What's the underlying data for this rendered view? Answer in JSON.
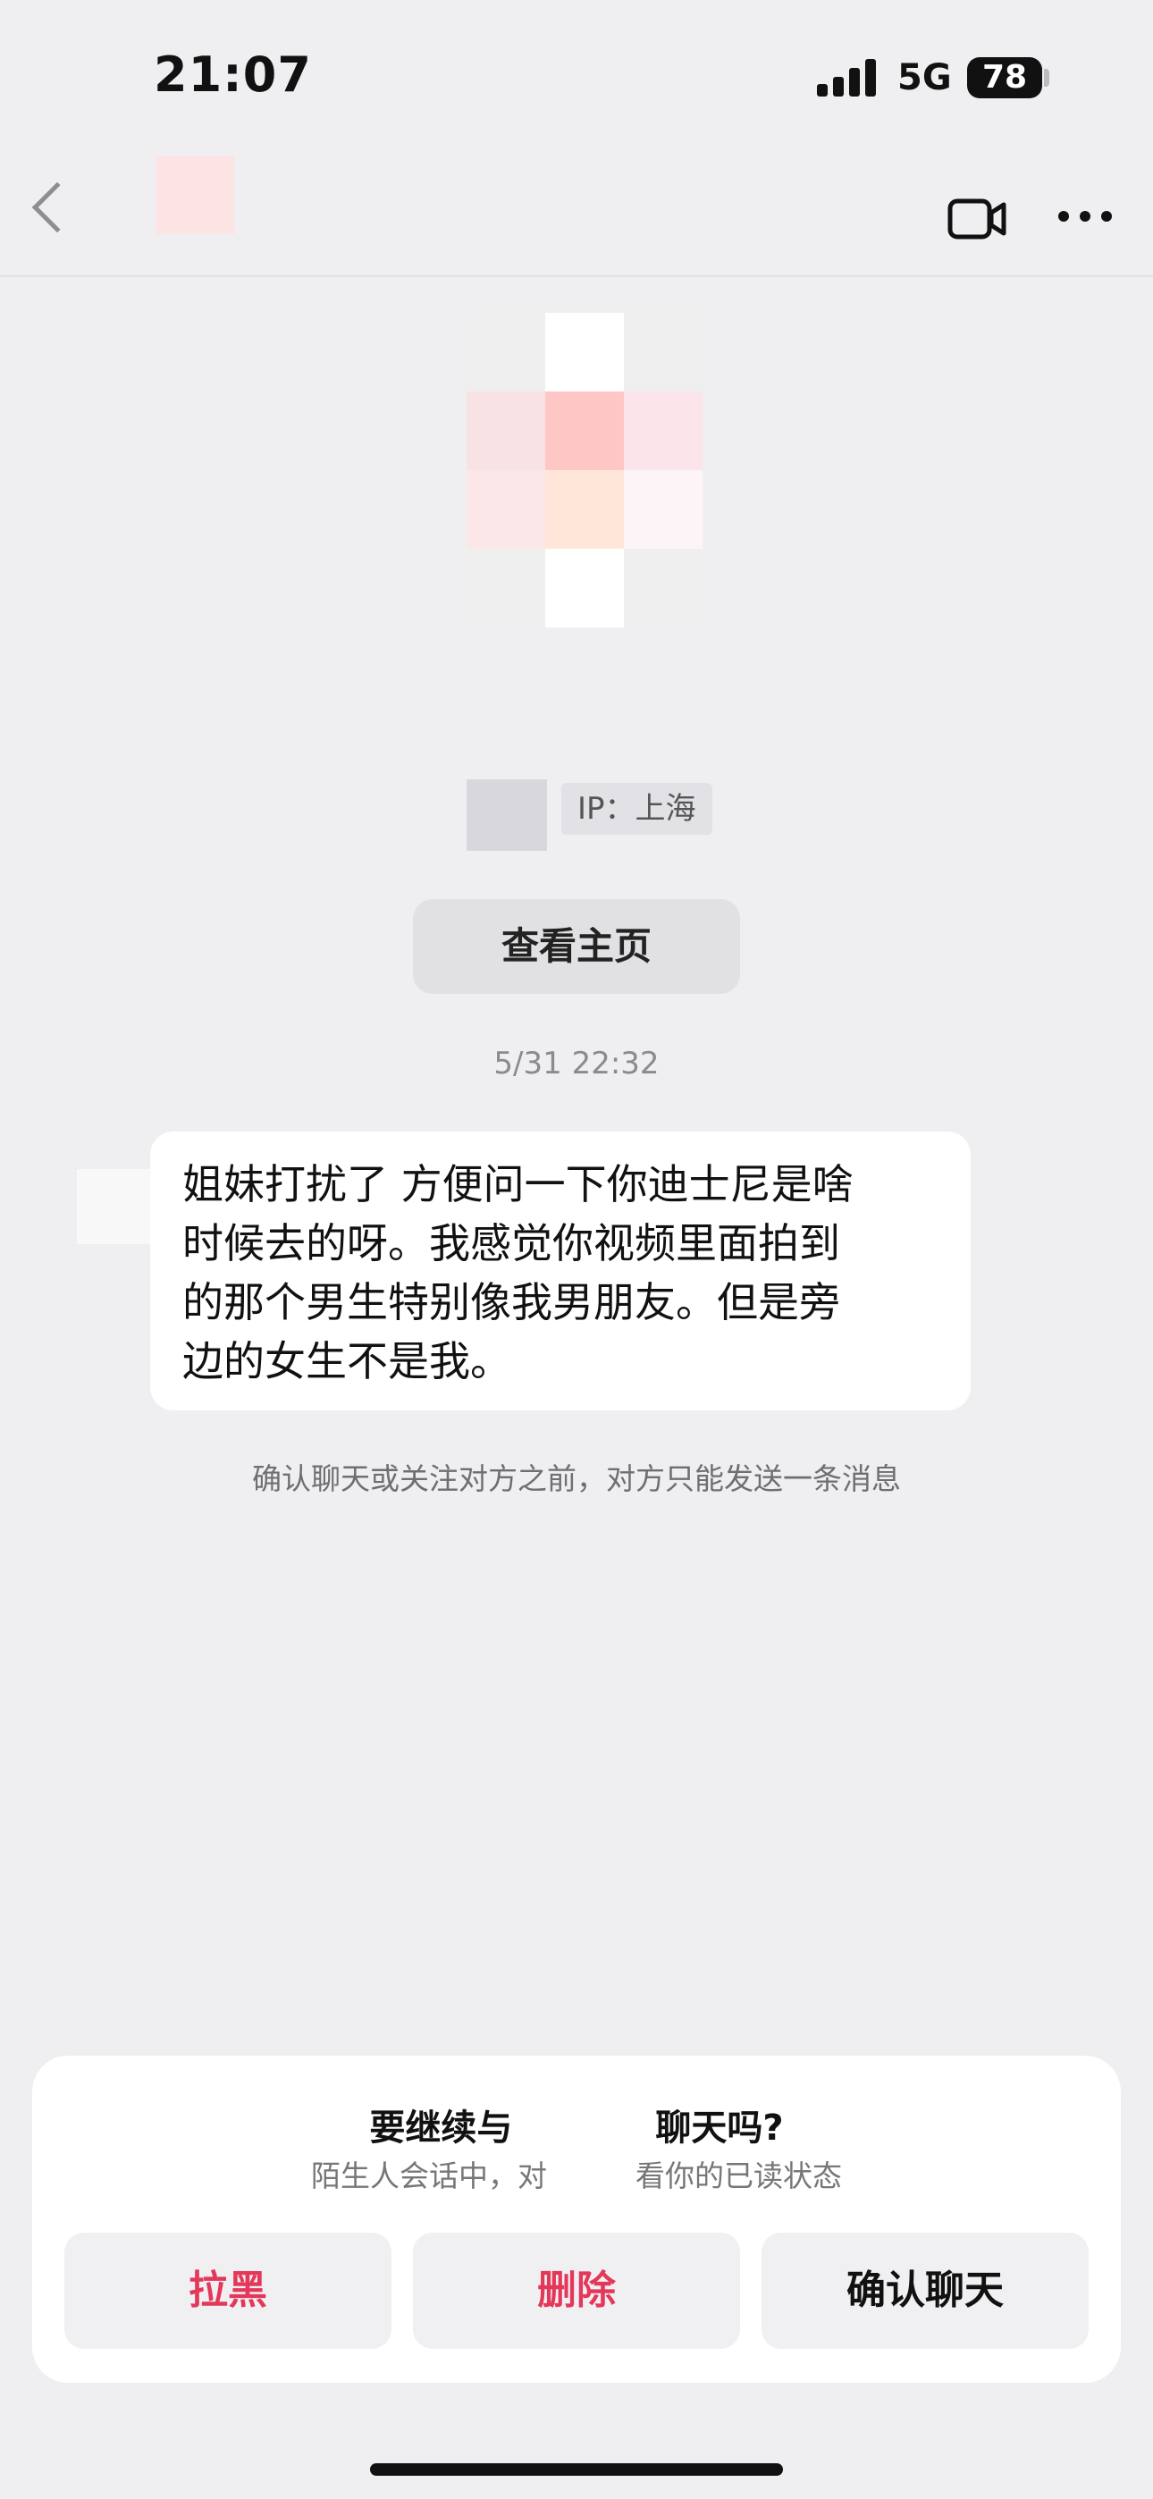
{
  "status_bar": {
    "time": "21:07",
    "network": "5G",
    "battery": "78"
  },
  "nav": {
    "icons": {
      "back": "chevron-left-icon",
      "video": "video-camera-icon",
      "more": "more-dots-icon"
    }
  },
  "profile": {
    "ip_label": "IP：上海",
    "view_profile_button": "查看主页"
  },
  "conversation": {
    "timestamp": "5/31 22:32",
    "message_lines": [
      "姐妹打扰了 方便问一下你迪士尼是啥",
      "时候去的呀。我感觉你视频里面拍到",
      "的那个男生特别像我男朋友。但是旁",
      "边的女生不是我。"
    ],
    "notice": "确认聊天或关注对方之前，对方只能发送一条消息"
  },
  "sheet": {
    "title": "要继续与　　　　聊天吗?",
    "subtitle": "陌生人会话中，对　　　看你的已读状态",
    "buttons": {
      "block": "拉黑",
      "delete": "删除",
      "confirm": "确认聊天"
    }
  },
  "colors": {
    "background": "#efeff1",
    "danger": "#e4385a",
    "bubble": "#ffffff",
    "card": "#ffffff"
  }
}
